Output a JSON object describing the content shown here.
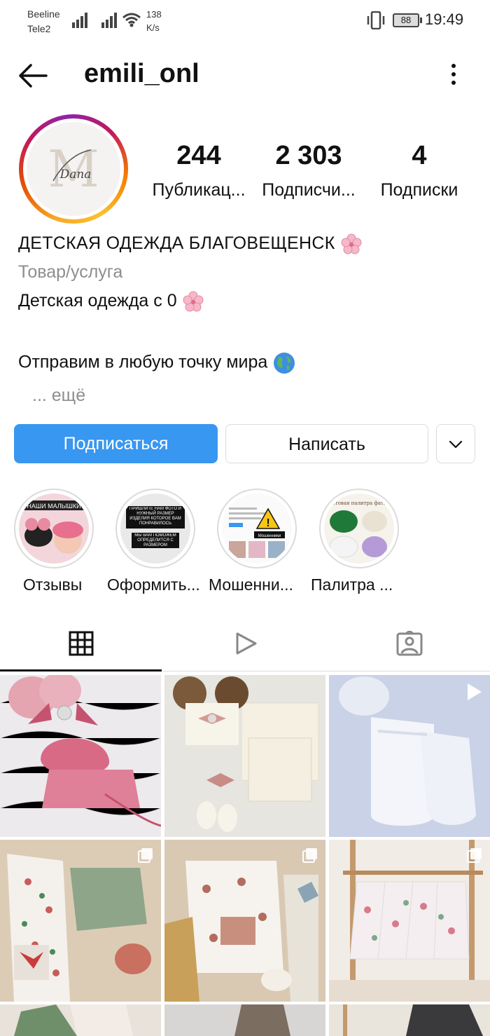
{
  "status_bar": {
    "carrier1": "Beeline",
    "carrier2": "Tele2",
    "net_speed": "138",
    "net_unit": "K/s",
    "battery": "88",
    "time": "19:49"
  },
  "header": {
    "username": "emili_onl"
  },
  "profile": {
    "avatar_text": "Dana",
    "stats": [
      {
        "value": "244",
        "label": "Публикац..."
      },
      {
        "value": "2 303",
        "label": "Подписчи..."
      },
      {
        "value": "4",
        "label": "Подписки"
      }
    ],
    "bio_name": "ДЕТСКАЯ ОДЕЖДА БЛАГОВЕЩЕНСК",
    "category": "Товар/услуга",
    "bio_line1": "Детская одежда с 0",
    "bio_line2": "Отправим в любую точку мира",
    "more": "... ещё"
  },
  "buttons": {
    "follow": "Подписаться",
    "message": "Написать"
  },
  "highlights": [
    {
      "label": "Отзывы",
      "caption": "НАШИ МАЛЫШКИ"
    },
    {
      "label": "Оформить...",
      "caption": "ПРИШЛИТЕ НАМ ФОТО И НУЖНЫЙ РАЗМЕР ИЗДЕЛИЯ КОТОРОЕ ВАМ ПОНРАВИЛОСЬ",
      "caption2": "МЫ ВАМ ПОМОЖЕМ ОПРЕДЕЛИТСЯ С РАЗМЕРОМ"
    },
    {
      "label": "Мошенни...",
      "caption": "Мошенники"
    },
    {
      "label": "Палитра ...",
      "caption": "Цветовая палитра фатина"
    }
  ],
  "tabs": [
    {
      "icon": "grid-icon"
    },
    {
      "icon": "reels-icon"
    },
    {
      "icon": "tagged-icon"
    }
  ],
  "colors": {
    "accent": "#3897f0",
    "border": "#dbdbdb",
    "muted": "#8e8e8e"
  }
}
